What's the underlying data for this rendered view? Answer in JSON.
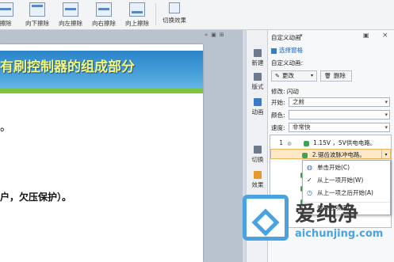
{
  "toolbar": {
    "items": [
      "擦除",
      "向下擦除",
      "向左擦除",
      "向右擦除",
      "向上擦除"
    ],
    "switch_effect": "切换效果"
  },
  "slide": {
    "title": "有刷控制器的组成部分",
    "bullet": "。",
    "body": "户，欠压保护）。"
  },
  "slide_tabs": [
    "«",
    "▣",
    "⊞"
  ],
  "side_bar": [
    "新建",
    "版式",
    "动画",
    "切换",
    "效果",
    "形状"
  ],
  "pane": {
    "title": "自定义动画",
    "select_pane": "选择窗格",
    "section_label": "自定义动画:",
    "change_label": "更改",
    "delete_label": "删除",
    "modify_label": "修改: 闪动",
    "start_label": "开始:",
    "start_value": "之前",
    "color_label": "颜色:",
    "color_value": "",
    "speed_label": "速度:",
    "speed_value": "非常快"
  },
  "anim_list": [
    {
      "num": "1",
      "text": "1.15V ，5V供电电路。"
    },
    {
      "num": "",
      "text": "2.锯齿波脉冲电路。"
    }
  ],
  "context_menu": [
    {
      "label": "单击开始(C)"
    },
    {
      "label": "从上一项开始(W)"
    },
    {
      "label": "从上一项之后开始(A)"
    },
    {
      "label": "效果选项(E)..."
    }
  ],
  "watermark": {
    "text": "爱纯净",
    "url": "aichunjing.com"
  }
}
